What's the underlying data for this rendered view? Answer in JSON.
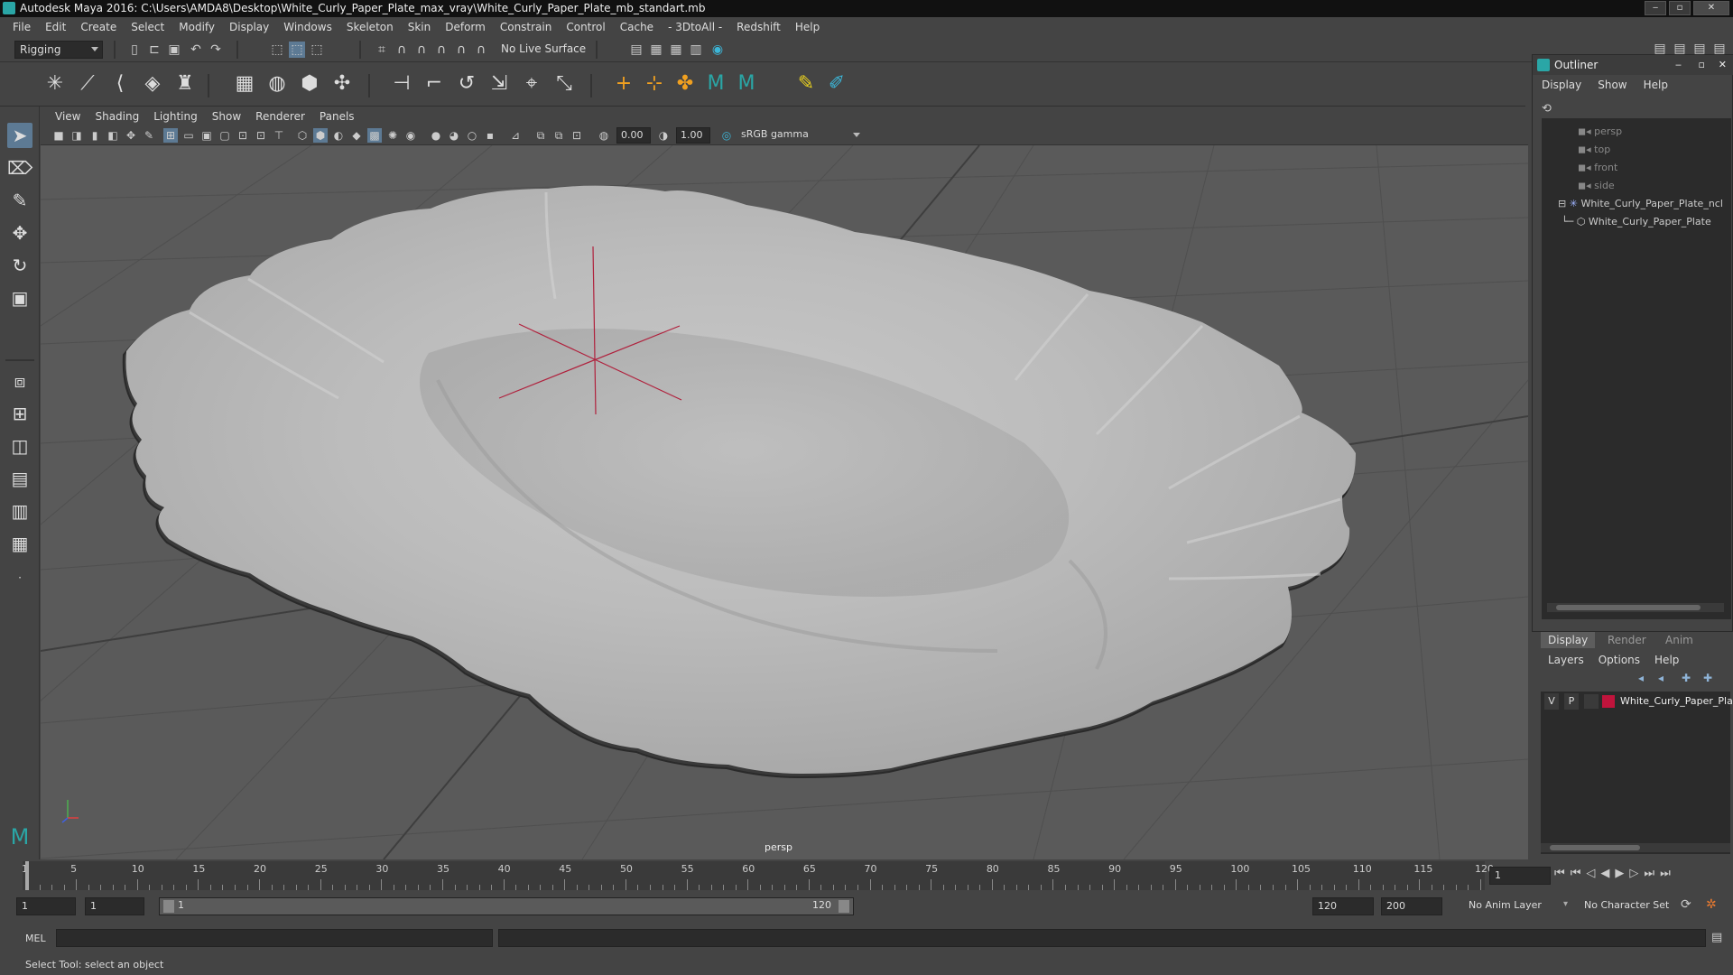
{
  "window": {
    "title": "Autodesk Maya 2016: C:\\Users\\AMDA8\\Desktop\\White_Curly_Paper_Plate_max_vray\\White_Curly_Paper_Plate_mb_standart.mb"
  },
  "menubar": [
    "File",
    "Edit",
    "Create",
    "Select",
    "Modify",
    "Display",
    "Windows",
    "Skeleton",
    "Skin",
    "Deform",
    "Constrain",
    "Control",
    "Cache",
    "- 3DtoAll -",
    "Redshift",
    "Help"
  ],
  "statusline": {
    "mode": "Rigging",
    "live_surface": "No Live Surface"
  },
  "panel": {
    "menus": [
      "View",
      "Shading",
      "Lighting",
      "Show",
      "Renderer",
      "Panels"
    ],
    "exposure": "0.00",
    "gamma": "1.00",
    "color_space": "sRGB gamma",
    "camera": "persp"
  },
  "outliner": {
    "title": "Outliner",
    "menus": [
      "Display",
      "Show",
      "Help"
    ],
    "items": [
      {
        "label": "persp",
        "dim": true
      },
      {
        "label": "top",
        "dim": true
      },
      {
        "label": "front",
        "dim": true
      },
      {
        "label": "side",
        "dim": true
      },
      {
        "label": "White_Curly_Paper_Plate_ncl",
        "dim": false
      },
      {
        "label": "White_Curly_Paper_Plate",
        "dim": false
      }
    ]
  },
  "layer_editor": {
    "tabs": [
      "Display",
      "Render",
      "Anim"
    ],
    "menus": [
      "Layers",
      "Options",
      "Help"
    ],
    "layer": {
      "v": "V",
      "p": "P",
      "name": "White_Curly_Paper_Pla",
      "color": "#c0143c"
    }
  },
  "timeline": {
    "ticks": [
      "1",
      "5",
      "10",
      "15",
      "20",
      "25",
      "30",
      "35",
      "40",
      "45",
      "50",
      "55",
      "60",
      "65",
      "70",
      "75",
      "80",
      "85",
      "90",
      "95",
      "100",
      "105",
      "110",
      "115",
      "120"
    ],
    "current_frame": "1"
  },
  "range": {
    "start": "1",
    "inner_start": "1",
    "slider_start": "1",
    "slider_end": "120",
    "end": "120",
    "outer_end": "200",
    "anim_layer": "No Anim Layer",
    "character_set": "No Character Set"
  },
  "command": {
    "mode": "MEL"
  },
  "help_line": "Select Tool: select an object",
  "colors": {
    "accent": "#2aa6a6",
    "pivot": "#b0203c"
  }
}
